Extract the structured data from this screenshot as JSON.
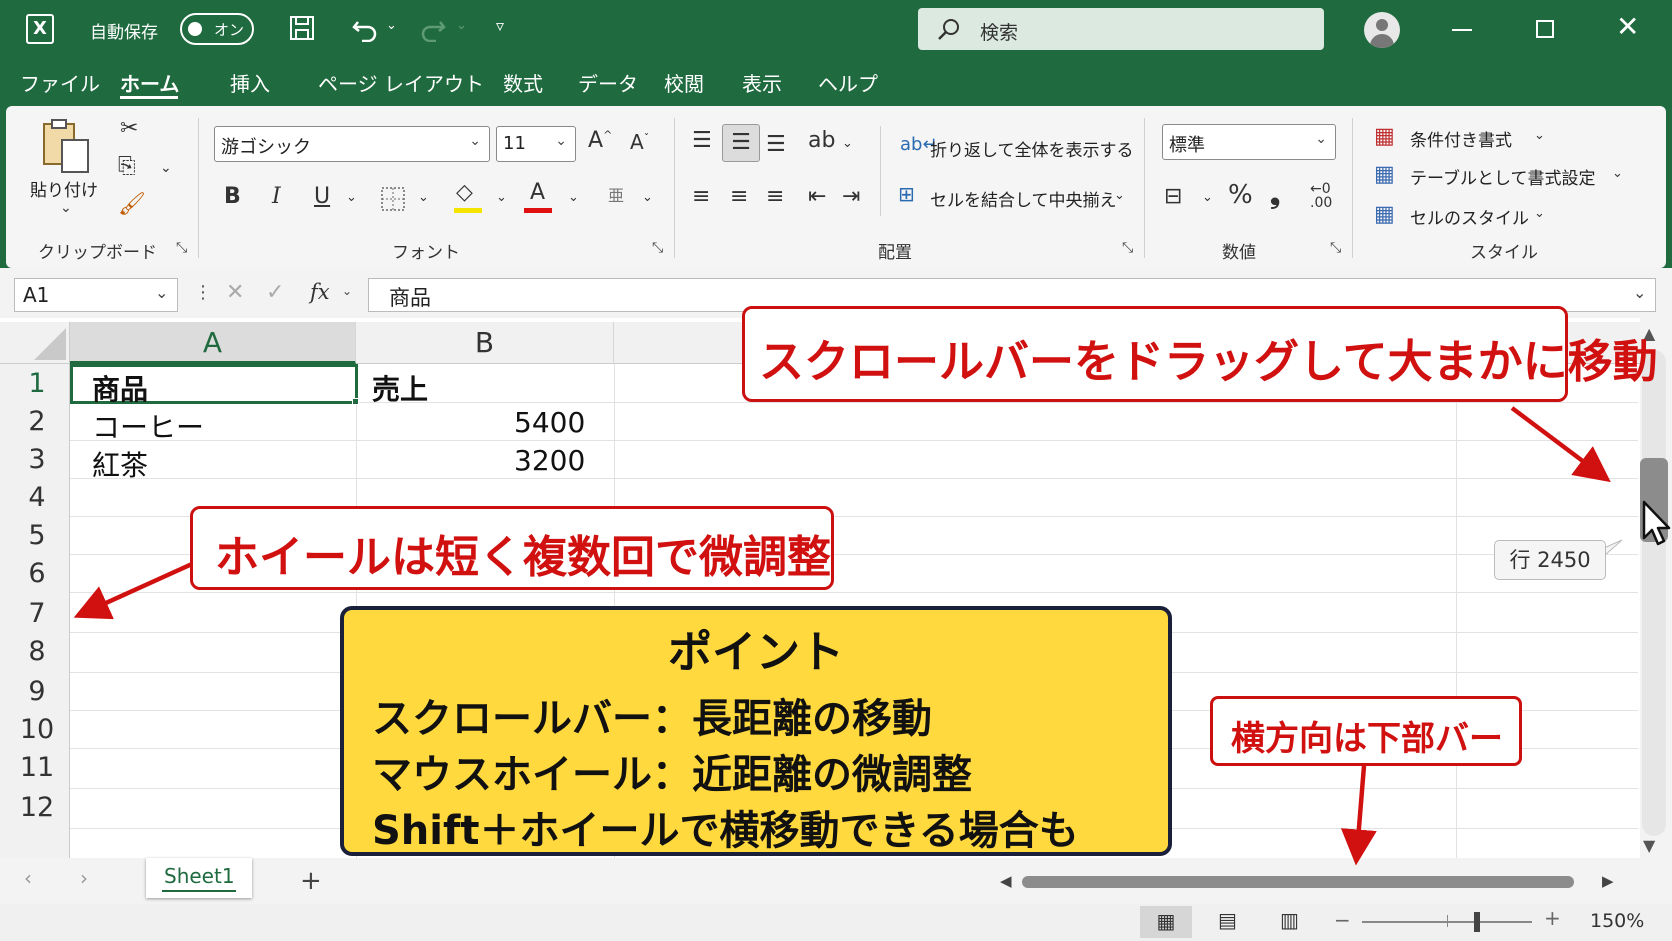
{
  "titlebar": {
    "autosave_label": "自動保存",
    "autosave_state": "オン",
    "search_placeholder": "検索"
  },
  "menu": {
    "items": [
      "ファイル",
      "ホーム",
      "挿入",
      "ページ レイアウト",
      "数式",
      "データ",
      "校閲",
      "表示",
      "ヘルプ"
    ],
    "active": "ホーム"
  },
  "ribbon": {
    "clipboard": {
      "paste_label": "貼り付け",
      "group_label": "クリップボード"
    },
    "font": {
      "font_name": "游ゴシック",
      "font_size": "11",
      "bold": "B",
      "italic": "I",
      "underline": "U",
      "group_label": "フォント"
    },
    "alignment": {
      "wrap_text": "折り返して全体を表示する",
      "merge_center": "セルを結合して中央揃え",
      "group_label": "配置"
    },
    "number": {
      "format": "標準",
      "percent": "%",
      "comma": "❟",
      "group_label": "数値"
    },
    "styles": {
      "conditional": "条件付き書式",
      "table": "テーブルとして書式設定",
      "cell_styles": "セルのスタイル",
      "group_label": "スタイル"
    }
  },
  "formula_bar": {
    "name_box": "A1",
    "fx": "fx",
    "content": "商品"
  },
  "grid": {
    "columns": [
      "A",
      "B"
    ],
    "rows": [
      "1",
      "2",
      "3",
      "4",
      "5",
      "6",
      "7",
      "8",
      "9",
      "10",
      "11",
      "12"
    ],
    "cells": {
      "A1": "商品",
      "B1": "売上",
      "A2": "コーヒー",
      "B2": "5400",
      "A3": "紅茶",
      "B3": "3200"
    }
  },
  "sheets": {
    "tabs": [
      "Sheet1"
    ],
    "add": "+"
  },
  "statusbar": {
    "zoom": "150%"
  },
  "annotations": {
    "scrollbar_note": "スクロールバーをドラッグして大まかに移動",
    "wheel_note": "ホイールは短く複数回で微調整",
    "row_tooltip": "行 2450",
    "horizontal_note": "横方向は下部バー",
    "point_title": "ポイント",
    "point_lines": [
      "スクロールバー：長距離の移動",
      "マウスホイール：近距離の微調整",
      "Shift＋ホイールで横移動できる場合も"
    ]
  },
  "colors": {
    "excel_green": "#1f6b3f",
    "callout_red": "#cc1010",
    "point_yellow": "#ffd93d"
  }
}
